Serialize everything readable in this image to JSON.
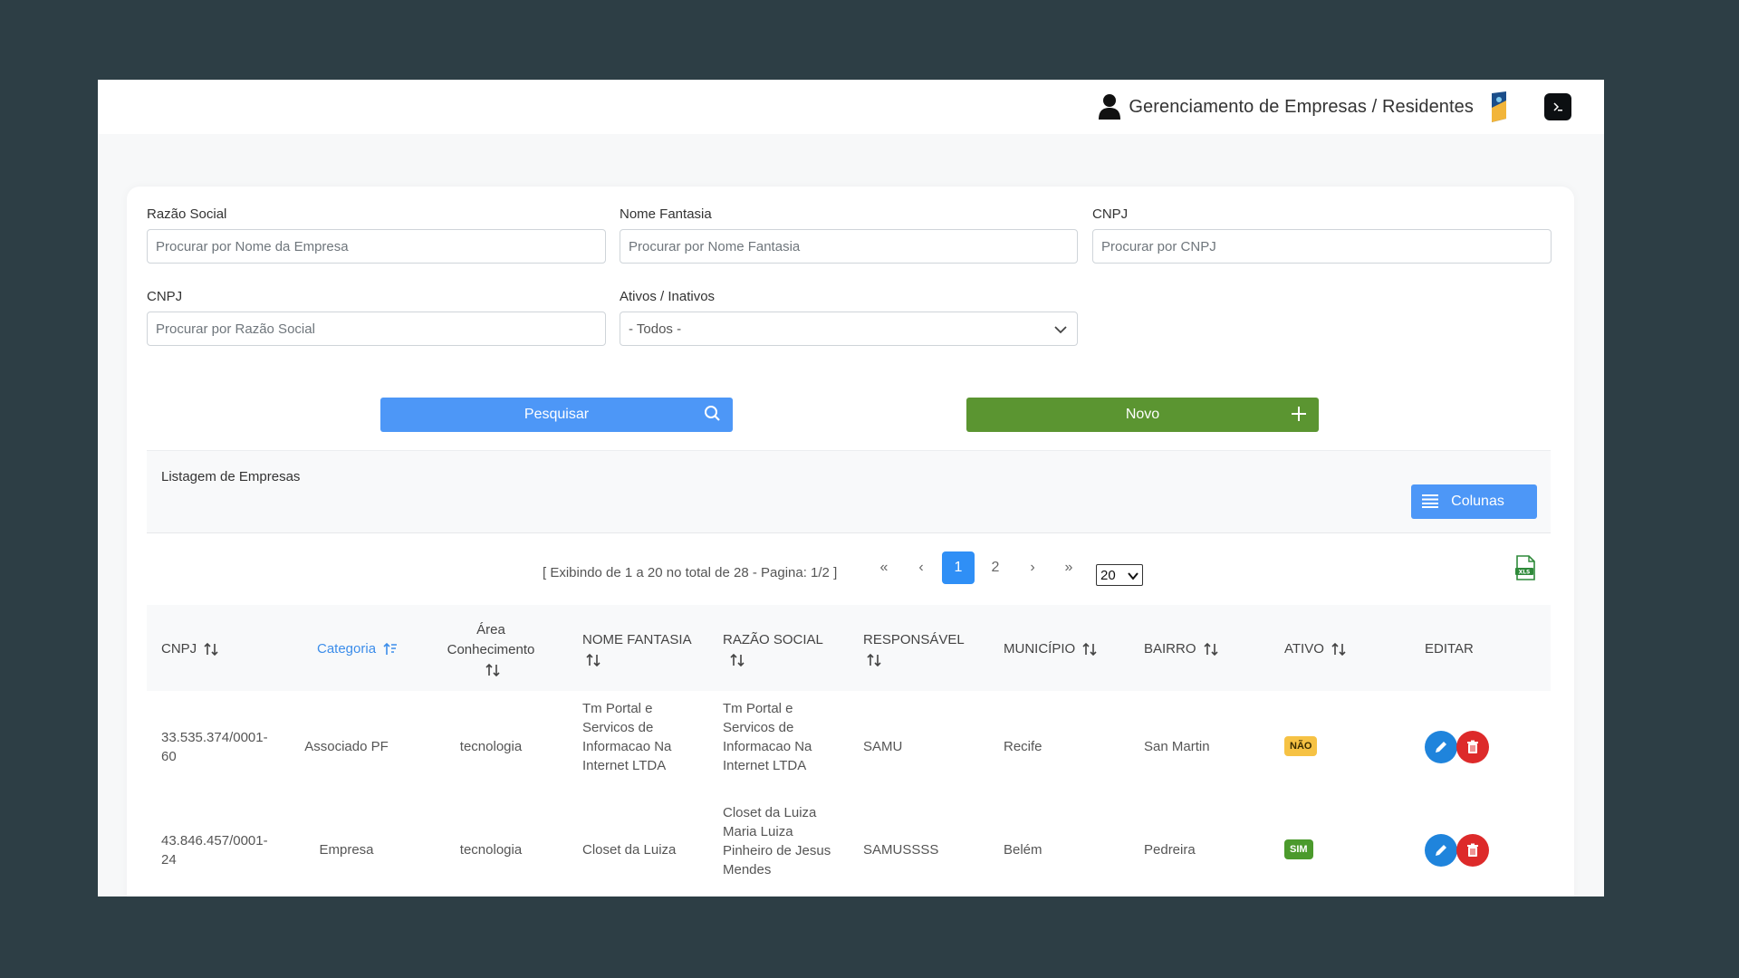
{
  "header": {
    "title": "Gerenciamento de Empresas / Residentes",
    "icons": [
      "user-icon",
      "brand-logo",
      "app-logo"
    ]
  },
  "filters": {
    "razao_social": {
      "label": "Razão Social",
      "placeholder": "Procurar por Nome da Empresa"
    },
    "nome_fantasia": {
      "label": "Nome Fantasia",
      "placeholder": "Procurar por Nome Fantasia"
    },
    "cnpj": {
      "label": "CNPJ",
      "placeholder": "Procurar por CNPJ"
    },
    "cnpj2": {
      "label": "CNPJ",
      "placeholder": "Procurar por Razão Social"
    },
    "ativos": {
      "label": "Ativos / Inativos",
      "value": "- Todos -"
    }
  },
  "actions": {
    "search_label": "Pesquisar",
    "new_label": "Novo"
  },
  "list": {
    "title": "Listagem de Empresas",
    "columns_button": "Colunas"
  },
  "pagination": {
    "info": "[ Exibindo de 1 a 20 no total de 28 - Pagina: 1/2 ]",
    "first": "«",
    "prev": "‹",
    "pages": [
      "1",
      "2"
    ],
    "current_page": "1",
    "next": "›",
    "last": "»",
    "page_size": "20"
  },
  "table": {
    "headers": {
      "cnpj": "CNPJ",
      "categoria": "Categoria",
      "area_1": "Área",
      "area_2": "Conhecimento",
      "nome_fantasia": "NOME FANTASIA",
      "razao_social": "RAZÃO SOCIAL",
      "responsavel": "RESPONSÁVEL",
      "municipio": "MUNICÍPIO",
      "bairro": "BAIRRO",
      "ativo": "ATIVO",
      "editar": "EDITAR"
    },
    "rows": [
      {
        "cnpj_1": "33.535.374/0001-",
        "cnpj_2": "60",
        "categoria": "Associado PF",
        "area": "tecnologia",
        "nome_fantasia": [
          "Tm Portal e",
          "Servicos de",
          "Informacao Na",
          "Internet LTDA"
        ],
        "razao_social": [
          "Tm Portal e",
          "Servicos de",
          "Informacao Na",
          "Internet LTDA"
        ],
        "responsavel": "SAMU",
        "municipio": "Recife",
        "bairro": "San Martin",
        "ativo": "NÃO",
        "ativo_color": "#f6c244"
      },
      {
        "cnpj_1": "43.846.457/0001-",
        "cnpj_2": "24",
        "categoria": "Empresa",
        "area": "tecnologia",
        "nome_fantasia": [
          "Closet da Luiza"
        ],
        "razao_social": [
          "Closet da Luiza",
          "Maria Luiza",
          "Pinheiro de Jesus",
          "Mendes"
        ],
        "responsavel": "SAMUSSSS",
        "municipio": "Belém",
        "bairro": "Pedreira",
        "ativo": "SIM",
        "ativo_color": "#4b9a2c"
      }
    ]
  },
  "colors": {
    "primary": "#4d97f7",
    "success": "#5b9531",
    "danger": "#dd2a2a",
    "edit": "#1f84dc",
    "page_active": "#2f8ff6",
    "background": "#2d3e45"
  }
}
